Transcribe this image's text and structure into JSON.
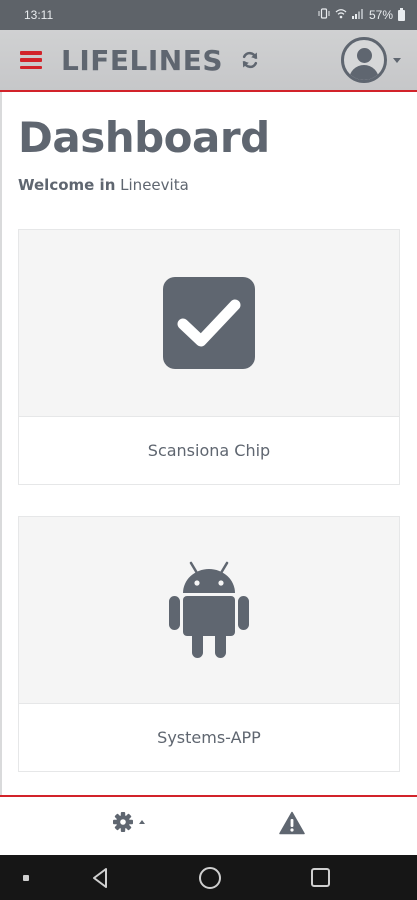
{
  "status_bar": {
    "time": "13:11",
    "battery": "57%",
    "icons": [
      "vibrate-icon",
      "wifi-icon",
      "signal-icon",
      "battery-icon"
    ]
  },
  "header": {
    "title": "LIFELINES",
    "menu_icon": "hamburger-icon",
    "refresh_icon": "refresh-icon",
    "user_icon": "user-circle-icon",
    "accent_color": "#d2232a",
    "text_color": "#5f6670"
  },
  "main": {
    "page_title": "Dashboard",
    "welcome_label": "Welcome in",
    "welcome_name": "Lineevita",
    "cards": [
      {
        "label": "Scansiona Chip",
        "icon": "checkbox-checked-icon"
      },
      {
        "label": "Systems-APP",
        "icon": "android-icon"
      }
    ]
  },
  "footer": {
    "settings_icon": "gear-icon",
    "alert_icon": "warning-icon"
  },
  "nav_bar": {
    "buttons": [
      "menu-dot",
      "back",
      "home",
      "recents"
    ]
  }
}
